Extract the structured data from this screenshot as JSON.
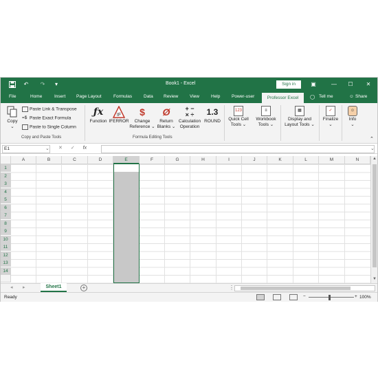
{
  "title": "Book1 - Excel",
  "signin": "Sign in",
  "quick_access": {
    "save": "save-icon",
    "undo": "↶",
    "redo": "↷",
    "customize": "▾"
  },
  "window_controls": {
    "ribbon_options": "▣",
    "minimize": "—",
    "maximize": "☐",
    "close": "✕"
  },
  "tabs": [
    "File",
    "Home",
    "Insert",
    "Page Layout",
    "Formulas",
    "Data",
    "Review",
    "View",
    "Help",
    "Power-user",
    "Professor Excel"
  ],
  "tab_active": "Professor Excel",
  "tell_me": "Tell me",
  "share": "Share",
  "ribbon": {
    "copy": "Copy",
    "paste_link": "Paste Link & Transpose",
    "paste_exact": "Paste Exact Formula",
    "paste_single": "Paste to Single Column",
    "group_copy": "Copy and Paste Tools",
    "function": "Function",
    "iferror": "IFERROR",
    "change_ref_1": "Change",
    "change_ref_2": "Reference",
    "return_blanks_1": "Return",
    "return_blanks_2": "Blanks",
    "calc_op_1": "Calculation",
    "calc_op_2": "Operation",
    "round": "ROUND",
    "group_formula": "Formula Editing Tools",
    "quick_cell_1": "Quick Cell",
    "quick_cell_2": "Tools",
    "workbook_1": "Workbook",
    "workbook_2": "Tools",
    "display_1": "Display and",
    "display_2": "Layout Tools",
    "finalize": "Finalize",
    "info": "Info",
    "round_icon": "1.3"
  },
  "namebox": "E1",
  "fx": "fx",
  "columns": [
    "A",
    "B",
    "C",
    "D",
    "E",
    "F",
    "G",
    "H",
    "I",
    "J",
    "K",
    "L",
    "M",
    "N"
  ],
  "rows": [
    "1",
    "2",
    "3",
    "4",
    "5",
    "6",
    "7",
    "8",
    "9",
    "10",
    "11",
    "12",
    "13",
    "14"
  ],
  "selected_column": "E",
  "sheet_tab": "Sheet1",
  "status": "Ready",
  "zoom": "100%",
  "accent_color": "#217346"
}
